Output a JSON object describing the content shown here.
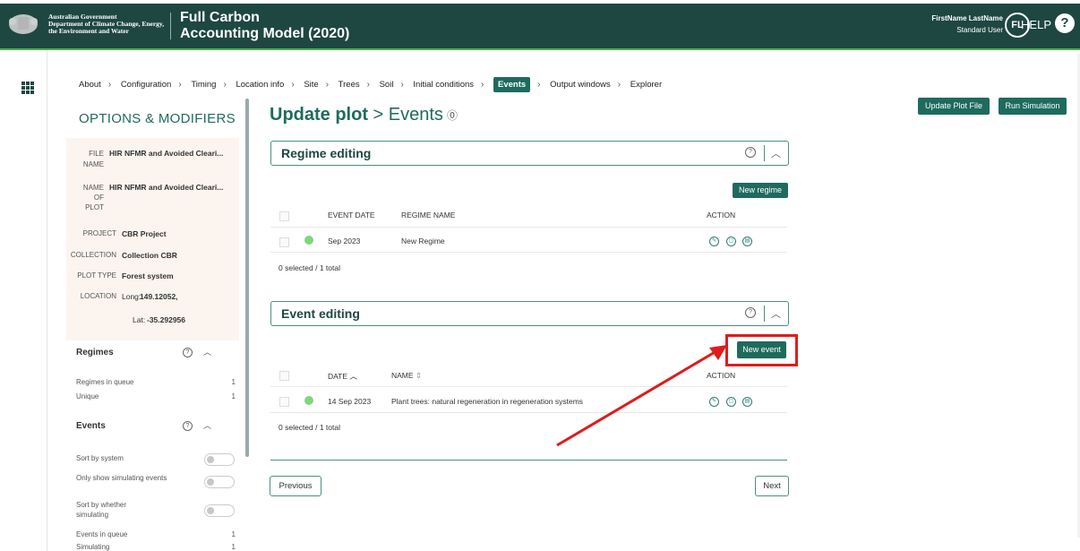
{
  "header": {
    "gov_line1": "Australian Government",
    "gov_line2": "Department of Climate Change, Energy,",
    "gov_line3": "the Environment and Water",
    "app_line1": "Full Carbon",
    "app_line2": "Accounting Model (2020)",
    "user_name": "FirstName LastName",
    "user_role": "Standard User",
    "avatar": "FL",
    "help": "HELP",
    "help_icon": "?"
  },
  "breadcrumbs": [
    "About",
    "Configuration",
    "Timing",
    "Location info",
    "Site",
    "Trees",
    "Soil",
    "Initial conditions",
    "Events",
    "Output windows",
    "Explorer"
  ],
  "toolbar": {
    "update_plot_file": "Update Plot File",
    "run_simulation": "Run Simulation"
  },
  "sidebar": {
    "title": "OPTIONS & MODIFIERS",
    "file_name_key": "FILE NAME",
    "file_name_val": "HIR NFMR and Avoided Cleari...",
    "name_of_plot_key": "NAME OF PLOT",
    "name_of_plot_val": "HIR NFMR and Avoided Cleari...",
    "project_key": "PROJECT",
    "project_val": "CBR Project",
    "collection_key": "COLLECTION",
    "collection_val": "Collection CBR",
    "plot_type_key": "PLOT TYPE",
    "plot_type_val": "Forest system",
    "location_key": "LOCATION",
    "long_label": "Long:",
    "long_val": "149.12052,",
    "lat_label": "Lat:",
    "lat_val": "-35.292956",
    "regimes_title": "Regimes",
    "regimes_in_queue": "Regimes in queue",
    "regimes_in_queue_n": "1",
    "unique": "Unique",
    "unique_n": "1",
    "events_title": "Events",
    "sort_by_system": "Sort by system",
    "only_show_simulating": "Only show simulating events",
    "sort_by_whether_simulating": "Sort by whether simulating",
    "events_in_queue": "Events in queue",
    "events_in_queue_n": "1",
    "simulating": "Simulating",
    "simulating_n": "1"
  },
  "main": {
    "title_bold": "Update plot",
    "title_rest": " > Events",
    "regime_panel": "Regime editing",
    "new_regime": "New regime",
    "regime_headers": {
      "date": "EVENT DATE",
      "name": "REGIME NAME",
      "action": "ACTION"
    },
    "regime_row": {
      "date": "Sep 2023",
      "name": "New Regime"
    },
    "regime_meta": "0 selected / 1 total",
    "event_panel": "Event editing",
    "new_event": "New event",
    "event_headers": {
      "date": "DATE",
      "name": "NAME",
      "action": "ACTION"
    },
    "event_row": {
      "date": "14 Sep 2023",
      "name": "Plant trees: natural regeneration in regeneration systems"
    },
    "event_meta": "0 selected / 1 total",
    "previous": "Previous",
    "next": "Next"
  },
  "colors": {
    "header_bg": "#1e4742",
    "accent": "#1e6b5e",
    "highlight": "#e01b1b",
    "status_dot": "#7ed67e"
  }
}
